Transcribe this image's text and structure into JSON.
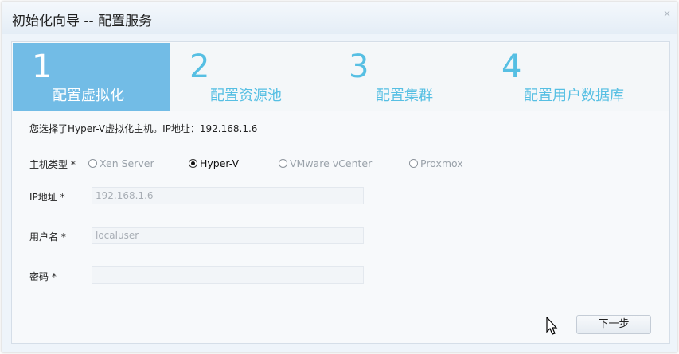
{
  "window": {
    "title": "初始化向导 -- 配置服务",
    "close_icon": "×"
  },
  "steps": [
    {
      "number": "1",
      "label": "配置虚拟化",
      "active": true
    },
    {
      "number": "2",
      "label": "配置资源池",
      "active": false
    },
    {
      "number": "3",
      "label": "配置集群",
      "active": false
    },
    {
      "number": "4",
      "label": "配置用户数据库",
      "active": false
    }
  ],
  "info_text": "您选择了Hyper-V虚拟化主机。IP地址：192.168.1.6",
  "form": {
    "host_type": {
      "label": "主机类型 *",
      "options": [
        "Xen Server",
        "Hyper-V",
        "VMware vCenter",
        "Proxmox"
      ],
      "selected": "Hyper-V"
    },
    "ip": {
      "label": "IP地址 *",
      "value": "192.168.1.6"
    },
    "username": {
      "label": "用户名 *",
      "value": "localuser"
    },
    "password": {
      "label": "密码 *",
      "value": ""
    }
  },
  "buttons": {
    "next_label": "下一步"
  },
  "colors": {
    "accent": "#72bce6",
    "step_text": "#56bfe3"
  }
}
